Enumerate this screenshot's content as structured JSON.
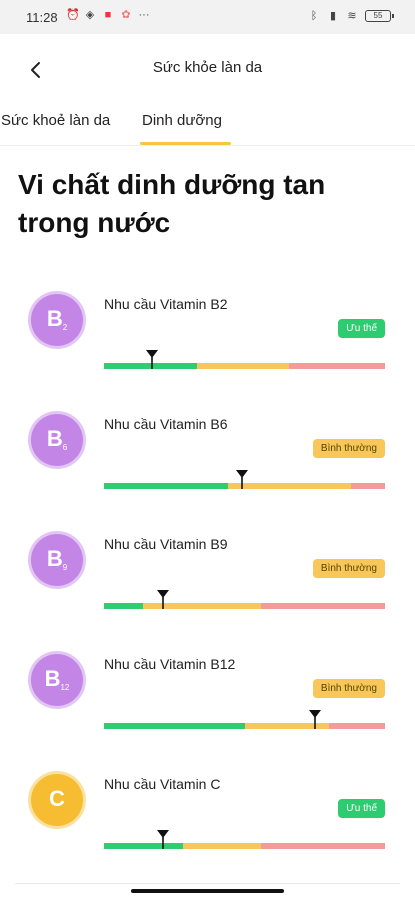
{
  "status_bar": {
    "time": "11:28",
    "battery": "55"
  },
  "app_bar": {
    "title": "Sức khỏe làn da"
  },
  "tabs": [
    {
      "label": "Sức khoẻ làn da",
      "active": false
    },
    {
      "label": "Dinh dưỡng",
      "active": true
    }
  ],
  "heading": "Vi chất dinh dưỡng tan trong nước",
  "colors": {
    "good": "#2ecc71",
    "normal": "#f7c75a",
    "bad": "#f59a9a",
    "accent_tab": "#f5c842",
    "badge_purple": "#c486e6",
    "badge_orange": "#f6bd33"
  },
  "vitamins": [
    {
      "letter": "B",
      "sub": "2",
      "label": "Nhu cầu Vitamin B2",
      "status": "Ưu thế",
      "status_type": "good",
      "badge_color": "purple",
      "marker_pct": 0.17,
      "segments": [
        0.33,
        0.33,
        0.34
      ]
    },
    {
      "letter": "B",
      "sub": "6",
      "label": "Nhu cầu Vitamin B6",
      "status": "Bình thường",
      "status_type": "normal",
      "badge_color": "purple",
      "marker_pct": 0.49,
      "segments": [
        0.44,
        0.44,
        0.12
      ]
    },
    {
      "letter": "B",
      "sub": "9",
      "label": "Nhu cầu Vitamin B9",
      "status": "Bình thường",
      "status_type": "normal",
      "badge_color": "purple",
      "marker_pct": 0.21,
      "segments": [
        0.14,
        0.42,
        0.44
      ]
    },
    {
      "letter": "B",
      "sub": "12",
      "label": "Nhu cầu Vitamin B12",
      "status": "Bình thường",
      "status_type": "normal",
      "badge_color": "purple",
      "marker_pct": 0.75,
      "segments": [
        0.5,
        0.3,
        0.2
      ]
    },
    {
      "letter": "C",
      "sub": "",
      "label": "Nhu cầu Vitamin C",
      "status": "Ưu thế",
      "status_type": "good",
      "badge_color": "orange",
      "marker_pct": 0.21,
      "segments": [
        0.28,
        0.28,
        0.44
      ]
    }
  ]
}
